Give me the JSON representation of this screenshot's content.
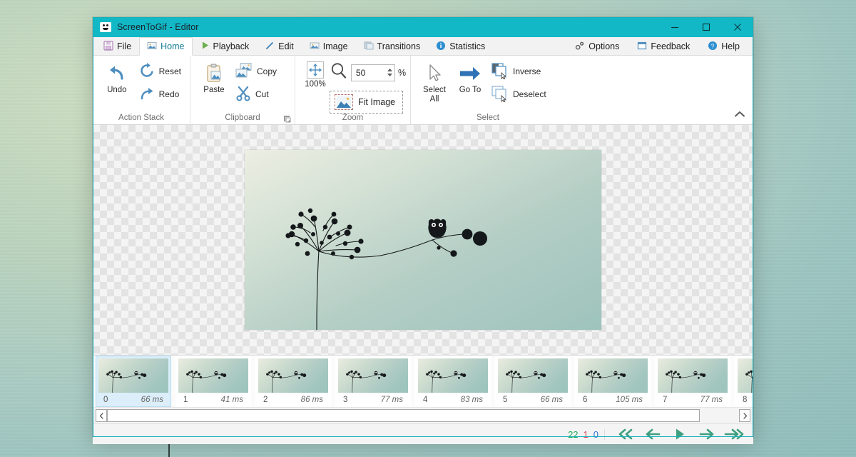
{
  "window": {
    "title": "ScreenToGif - Editor",
    "app_icon": "screentogif-icon",
    "minimize_label": "Minimize",
    "maximize_label": "Maximize",
    "close_label": "Close",
    "accent_color": "#12b8c6"
  },
  "tabs": [
    {
      "id": "file",
      "label": "File",
      "icon": "save-floppy-icon",
      "active": false
    },
    {
      "id": "home",
      "label": "Home",
      "icon": "image-frame-icon",
      "active": true
    },
    {
      "id": "playback",
      "label": "Playback",
      "icon": "play-icon",
      "active": false
    },
    {
      "id": "edit",
      "label": "Edit",
      "icon": "pencil-icon",
      "active": false
    },
    {
      "id": "image",
      "label": "Image",
      "icon": "picture-icon",
      "active": false
    },
    {
      "id": "transitions",
      "label": "Transitions",
      "icon": "layers-icon",
      "active": false
    },
    {
      "id": "statistics",
      "label": "Statistics",
      "icon": "info-circle-icon",
      "active": false
    }
  ],
  "tabs_right": [
    {
      "id": "options",
      "label": "Options",
      "icon": "gear-link-icon"
    },
    {
      "id": "feedback",
      "label": "Feedback",
      "icon": "window-icon"
    },
    {
      "id": "help",
      "label": "Help",
      "icon": "question-circle-icon"
    }
  ],
  "ribbon": {
    "collapse_label": "Collapse the Ribbon",
    "groups": [
      {
        "id": "action-stack",
        "label": "Action Stack",
        "buttons": [
          {
            "id": "undo",
            "label": "Undo",
            "icon": "undo-arrow-icon"
          },
          {
            "id": "reset",
            "label": "Reset",
            "icon": "reset-circular-arrow-icon"
          },
          {
            "id": "redo",
            "label": "Redo",
            "icon": "redo-arrow-icon"
          }
        ]
      },
      {
        "id": "clipboard",
        "label": "Clipboard",
        "buttons": [
          {
            "id": "paste",
            "label": "Paste",
            "icon": "clipboard-icon"
          },
          {
            "id": "copy",
            "label": "Copy",
            "icon": "copy-images-icon"
          },
          {
            "id": "cut",
            "label": "Cut",
            "icon": "scissors-icon"
          }
        ],
        "has_dialog_launcher": true
      },
      {
        "id": "zoom",
        "label": "Zoom",
        "buttons": [
          {
            "id": "zoom-100",
            "label": "100%",
            "icon": "fit-arrows-icon"
          },
          {
            "id": "fit-image",
            "label": "Fit Image",
            "icon": "picture-icon"
          }
        ],
        "zoom_value": "50",
        "zoom_unit": "%",
        "zoom_icon": "magnifier-icon",
        "spin_up": "spinner-up-icon",
        "spin_down": "spinner-down-icon"
      },
      {
        "id": "select",
        "label": "Select",
        "buttons": [
          {
            "id": "select-all",
            "label": "Select\nAll",
            "label_line1": "Select",
            "label_line2": "All",
            "icon": "cursor-arrow-icon"
          },
          {
            "id": "go-to",
            "label": "Go To",
            "icon": "right-arrow-icon"
          },
          {
            "id": "inverse",
            "label": "Inverse",
            "icon": "inverse-selection-icon"
          },
          {
            "id": "deselect",
            "label": "Deselect",
            "icon": "deselect-icon"
          }
        ]
      }
    ]
  },
  "canvas": {
    "name": "frame-preview",
    "description": "Wall decal of a dandelion tree with an owl perched on a branch, on a mint-green wall"
  },
  "filmstrip": {
    "frames": [
      {
        "index": "0",
        "duration": "66 ms",
        "selected": true
      },
      {
        "index": "1",
        "duration": "41 ms",
        "selected": false
      },
      {
        "index": "2",
        "duration": "86 ms",
        "selected": false
      },
      {
        "index": "3",
        "duration": "77 ms",
        "selected": false
      },
      {
        "index": "4",
        "duration": "83 ms",
        "selected": false
      },
      {
        "index": "5",
        "duration": "66 ms",
        "selected": false
      },
      {
        "index": "6",
        "duration": "105 ms",
        "selected": false
      },
      {
        "index": "7",
        "duration": "77 ms",
        "selected": false
      },
      {
        "index": "8",
        "duration": "",
        "selected": false
      }
    ],
    "scroll_left_icon": "chevron-left-icon",
    "scroll_right_icon": "chevron-right-icon"
  },
  "statusbar": {
    "total_frames": "22",
    "selected_frames": "1",
    "current_frame": "0",
    "total_color": "#1faa52",
    "selected_color": "#e0485a",
    "current_color": "#2f6fd0",
    "nav": [
      {
        "id": "first",
        "label": "First Frame",
        "icon": "double-chevron-left-icon"
      },
      {
        "id": "prev",
        "label": "Previous Frame",
        "icon": "arrow-left-icon"
      },
      {
        "id": "play",
        "label": "Play",
        "icon": "play-triangle-icon"
      },
      {
        "id": "next",
        "label": "Next Frame",
        "icon": "arrow-right-icon"
      },
      {
        "id": "last",
        "label": "Last Frame",
        "icon": "double-arrow-right-icon"
      }
    ]
  }
}
